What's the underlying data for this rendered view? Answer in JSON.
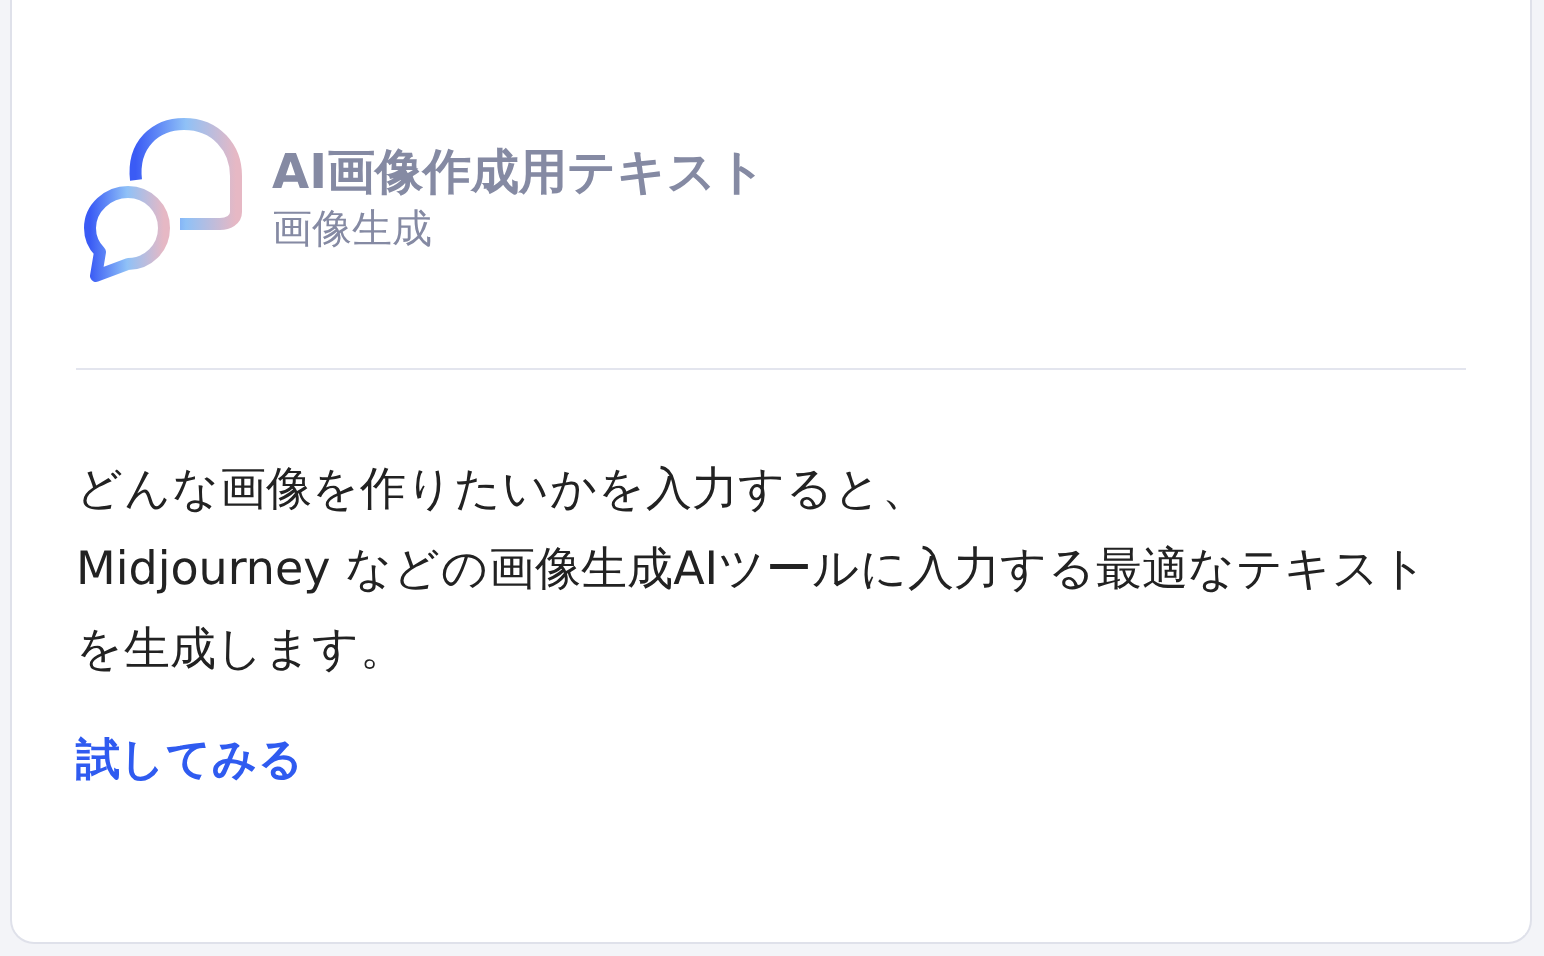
{
  "card": {
    "title": "AI画像作成用テキスト",
    "category": "画像生成",
    "description": "どんな画像を作りたいかを入力すると、\nMidjourney などの画像生成AIツールに入力する最適なテキストを生成します。",
    "link": "試してみる"
  }
}
